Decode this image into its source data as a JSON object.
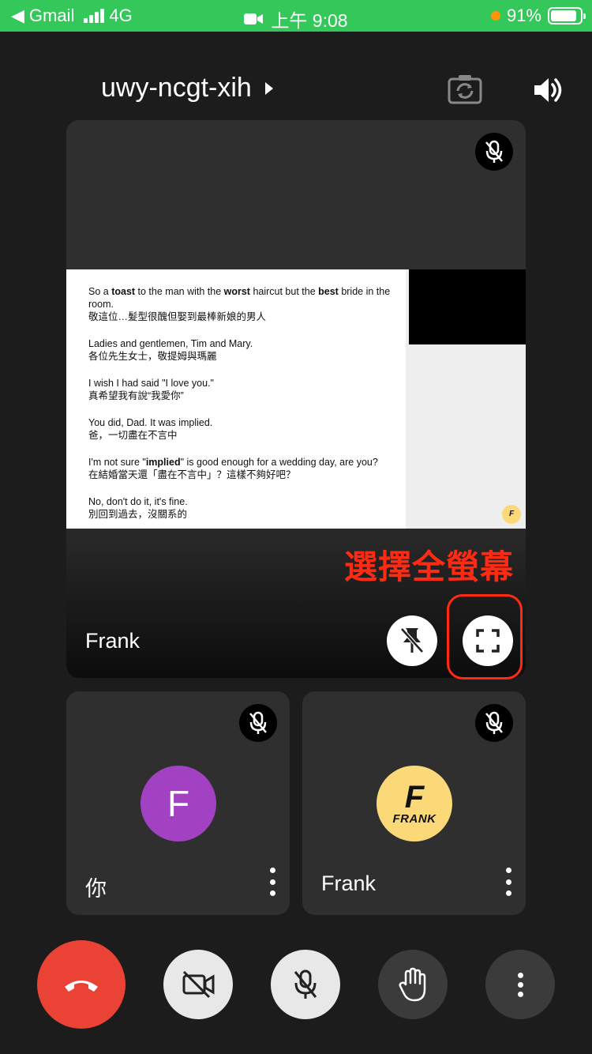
{
  "status_bar": {
    "back_app": "Gmail",
    "network": "4G",
    "time": "上午 9:08",
    "battery": "91%"
  },
  "header": {
    "meeting_code": "uwy-ncgt-xih"
  },
  "presentation": {
    "lines": [
      {
        "en_html": "So a <b>toast</b> to the man with the <b>worst</b> haircut but the <b>best</b> bride in the room.",
        "zh": "敬這位…髮型很醜但娶到最棒新娘的男人"
      },
      {
        "en_html": "Ladies and gentlemen, Tim and Mary.",
        "zh": "各位先生女士，敬提姆與瑪麗"
      },
      {
        "en_html": "I wish I had said \"I love you.\"",
        "zh": "真希望我有說“我愛你”"
      },
      {
        "en_html": "You did, Dad. It was implied.",
        "zh": "爸，一切盡在不言中"
      },
      {
        "en_html": "I'm not sure \"<b>implied</b>\" is good enough for a wedding day, are you?",
        "zh": "在結婚當天還「盡在不言中」？這樣不夠好吧？"
      },
      {
        "en_html": "No, don't do it, it's fine.",
        "zh": "別回到過去，沒關系的"
      }
    ]
  },
  "main_tile": {
    "name": "Frank",
    "annotation": "選擇全螢幕"
  },
  "tiles": [
    {
      "name": "你",
      "initial": "F"
    },
    {
      "name": "Frank",
      "logo_letter": "F",
      "logo_text": "FRANK"
    }
  ],
  "colors": {
    "status_green": "#34c759",
    "end_call_red": "#ea4335",
    "avatar_purple": "#a242c2",
    "logo_yellow": "#fcd978",
    "annotation_red": "#ff2a12"
  }
}
